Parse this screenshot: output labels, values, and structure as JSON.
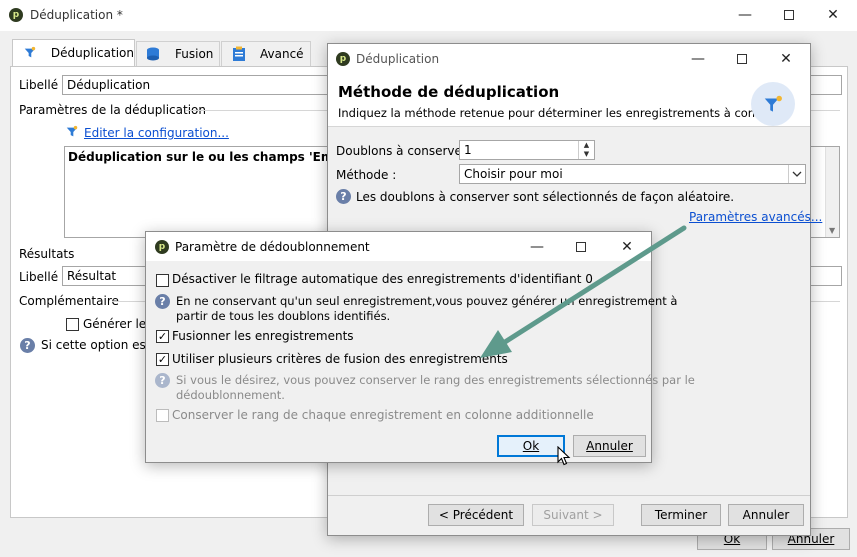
{
  "main_window": {
    "title": "Déduplication *",
    "tabs": [
      {
        "label": "Déduplication"
      },
      {
        "label": "Fusion"
      },
      {
        "label": "Avancé"
      }
    ],
    "libelle_label": "Libellé :",
    "libelle_value": "Déduplication",
    "params_section": "Paramètres de la déduplication",
    "edit_config_link": "Editer la configuration...",
    "summary_text": "Déduplication sur le ou les champs 'Email' avec",
    "results_section": "Résultats",
    "results_libelle_label": "Libellé :",
    "results_libelle_value": "Résultat",
    "complementary_section": "Complémentaire",
    "generate_checkbox_label": "Générer le c",
    "info_text": "Si cette option est c",
    "ok_button": "Ok",
    "cancel_button": "Annuler"
  },
  "method_dialog": {
    "title": "Déduplication",
    "heading": "Méthode de déduplication",
    "subheading": "Indiquez la méthode retenue pour déterminer les enregistrements à conserver",
    "doublons_label": "Doublons à conserver :",
    "doublons_value": "1",
    "methode_label": "Méthode :",
    "methode_value": "Choisir pour moi",
    "info_text": "Les doublons à conserver sont sélectionnés de façon aléatoire.",
    "advanced_link": "Paramètres avancés...",
    "prev_button": "< Précédent",
    "next_button": "Suivant >",
    "finish_button": "Terminer",
    "cancel_button": "Annuler"
  },
  "param_dialog": {
    "title": "Paramètre de dédoublonnement",
    "disable_filter_label": "Désactiver le filtrage automatique des enregistrements d'identifiant 0",
    "disable_filter_checked": false,
    "info1_line1": "En ne conservant qu'un seul enregistrement,vous pouvez générer un enregistrement à",
    "info1_line2": "partir de tous les doublons identifiés.",
    "merge_label": "Fusionner les enregistrements",
    "merge_checked": true,
    "multi_criteria_label": "Utiliser plusieurs critères de fusion des enregistrements",
    "multi_criteria_checked": true,
    "info2_line1": "Si vous le désirez, vous pouvez conserver le rang des enregistrements sélectionnés par le",
    "info2_line2": "dédoublonnement.",
    "keep_rank_label": "Conserver le rang de chaque enregistrement en colonne additionnelle",
    "keep_rank_checked": false,
    "ok_button": "Ok",
    "cancel_button": "Annuler"
  },
  "colors": {
    "arrow": "#5e9a8c",
    "link": "#0b4fd1",
    "funnel_blue": "#2e7bd6",
    "funnel_yellow": "#f2b632"
  }
}
